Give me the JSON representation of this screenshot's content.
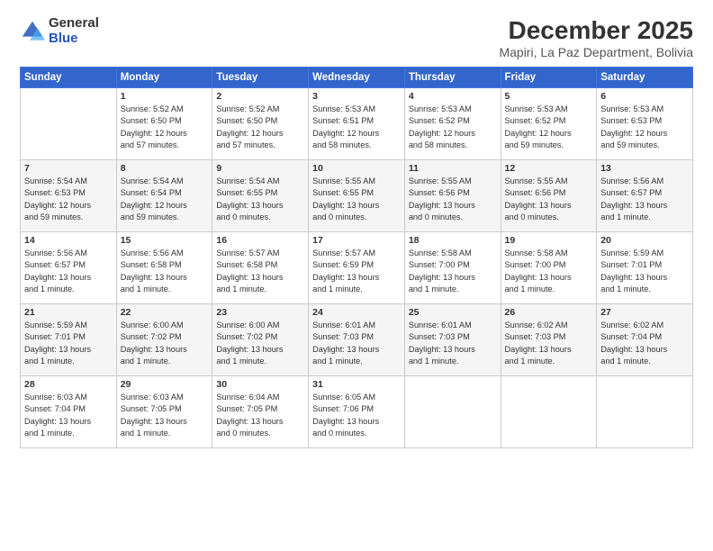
{
  "logo": {
    "general": "General",
    "blue": "Blue"
  },
  "title": "December 2025",
  "subtitle": "Mapiri, La Paz Department, Bolivia",
  "days_header": [
    "Sunday",
    "Monday",
    "Tuesday",
    "Wednesday",
    "Thursday",
    "Friday",
    "Saturday"
  ],
  "weeks": [
    [
      {
        "day": "",
        "info": ""
      },
      {
        "day": "1",
        "info": "Sunrise: 5:52 AM\nSunset: 6:50 PM\nDaylight: 12 hours\nand 57 minutes."
      },
      {
        "day": "2",
        "info": "Sunrise: 5:52 AM\nSunset: 6:50 PM\nDaylight: 12 hours\nand 57 minutes."
      },
      {
        "day": "3",
        "info": "Sunrise: 5:53 AM\nSunset: 6:51 PM\nDaylight: 12 hours\nand 58 minutes."
      },
      {
        "day": "4",
        "info": "Sunrise: 5:53 AM\nSunset: 6:52 PM\nDaylight: 12 hours\nand 58 minutes."
      },
      {
        "day": "5",
        "info": "Sunrise: 5:53 AM\nSunset: 6:52 PM\nDaylight: 12 hours\nand 59 minutes."
      },
      {
        "day": "6",
        "info": "Sunrise: 5:53 AM\nSunset: 6:53 PM\nDaylight: 12 hours\nand 59 minutes."
      }
    ],
    [
      {
        "day": "7",
        "info": "Sunrise: 5:54 AM\nSunset: 6:53 PM\nDaylight: 12 hours\nand 59 minutes."
      },
      {
        "day": "8",
        "info": "Sunrise: 5:54 AM\nSunset: 6:54 PM\nDaylight: 12 hours\nand 59 minutes."
      },
      {
        "day": "9",
        "info": "Sunrise: 5:54 AM\nSunset: 6:55 PM\nDaylight: 13 hours\nand 0 minutes."
      },
      {
        "day": "10",
        "info": "Sunrise: 5:55 AM\nSunset: 6:55 PM\nDaylight: 13 hours\nand 0 minutes."
      },
      {
        "day": "11",
        "info": "Sunrise: 5:55 AM\nSunset: 6:56 PM\nDaylight: 13 hours\nand 0 minutes."
      },
      {
        "day": "12",
        "info": "Sunrise: 5:55 AM\nSunset: 6:56 PM\nDaylight: 13 hours\nand 0 minutes."
      },
      {
        "day": "13",
        "info": "Sunrise: 5:56 AM\nSunset: 6:57 PM\nDaylight: 13 hours\nand 1 minute."
      }
    ],
    [
      {
        "day": "14",
        "info": "Sunrise: 5:56 AM\nSunset: 6:57 PM\nDaylight: 13 hours\nand 1 minute."
      },
      {
        "day": "15",
        "info": "Sunrise: 5:56 AM\nSunset: 6:58 PM\nDaylight: 13 hours\nand 1 minute."
      },
      {
        "day": "16",
        "info": "Sunrise: 5:57 AM\nSunset: 6:58 PM\nDaylight: 13 hours\nand 1 minute."
      },
      {
        "day": "17",
        "info": "Sunrise: 5:57 AM\nSunset: 6:59 PM\nDaylight: 13 hours\nand 1 minute."
      },
      {
        "day": "18",
        "info": "Sunrise: 5:58 AM\nSunset: 7:00 PM\nDaylight: 13 hours\nand 1 minute."
      },
      {
        "day": "19",
        "info": "Sunrise: 5:58 AM\nSunset: 7:00 PM\nDaylight: 13 hours\nand 1 minute."
      },
      {
        "day": "20",
        "info": "Sunrise: 5:59 AM\nSunset: 7:01 PM\nDaylight: 13 hours\nand 1 minute."
      }
    ],
    [
      {
        "day": "21",
        "info": "Sunrise: 5:59 AM\nSunset: 7:01 PM\nDaylight: 13 hours\nand 1 minute."
      },
      {
        "day": "22",
        "info": "Sunrise: 6:00 AM\nSunset: 7:02 PM\nDaylight: 13 hours\nand 1 minute."
      },
      {
        "day": "23",
        "info": "Sunrise: 6:00 AM\nSunset: 7:02 PM\nDaylight: 13 hours\nand 1 minute."
      },
      {
        "day": "24",
        "info": "Sunrise: 6:01 AM\nSunset: 7:03 PM\nDaylight: 13 hours\nand 1 minute."
      },
      {
        "day": "25",
        "info": "Sunrise: 6:01 AM\nSunset: 7:03 PM\nDaylight: 13 hours\nand 1 minute."
      },
      {
        "day": "26",
        "info": "Sunrise: 6:02 AM\nSunset: 7:03 PM\nDaylight: 13 hours\nand 1 minute."
      },
      {
        "day": "27",
        "info": "Sunrise: 6:02 AM\nSunset: 7:04 PM\nDaylight: 13 hours\nand 1 minute."
      }
    ],
    [
      {
        "day": "28",
        "info": "Sunrise: 6:03 AM\nSunset: 7:04 PM\nDaylight: 13 hours\nand 1 minute."
      },
      {
        "day": "29",
        "info": "Sunrise: 6:03 AM\nSunset: 7:05 PM\nDaylight: 13 hours\nand 1 minute."
      },
      {
        "day": "30",
        "info": "Sunrise: 6:04 AM\nSunset: 7:05 PM\nDaylight: 13 hours\nand 0 minutes."
      },
      {
        "day": "31",
        "info": "Sunrise: 6:05 AM\nSunset: 7:06 PM\nDaylight: 13 hours\nand 0 minutes."
      },
      {
        "day": "",
        "info": ""
      },
      {
        "day": "",
        "info": ""
      },
      {
        "day": "",
        "info": ""
      }
    ]
  ]
}
